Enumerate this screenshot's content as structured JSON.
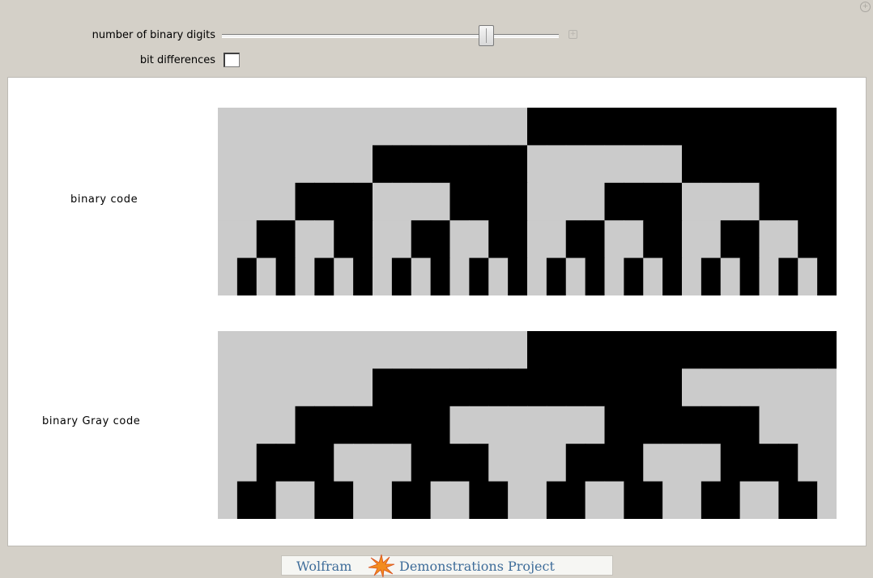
{
  "controls": {
    "digits_label": "number of binary digits",
    "bit_diff_label": "bit differences",
    "bit_differences_checked": false,
    "slider_value_fraction": 0.81,
    "plus_button_icon": "plus-icon"
  },
  "rows": [
    {
      "label": "binary code"
    },
    {
      "label": "binary Gray code"
    }
  ],
  "num_digits": 5,
  "colors": {
    "bit_one": "#000000",
    "bit_zero": "#cbcbcb",
    "panel": "#ffffff",
    "frame": "#d4d0c8"
  },
  "footer": {
    "wolfram": "Wolfram",
    "demonstrations": "Demonstrations Project",
    "logo_icon": "spikey-star-icon"
  }
}
